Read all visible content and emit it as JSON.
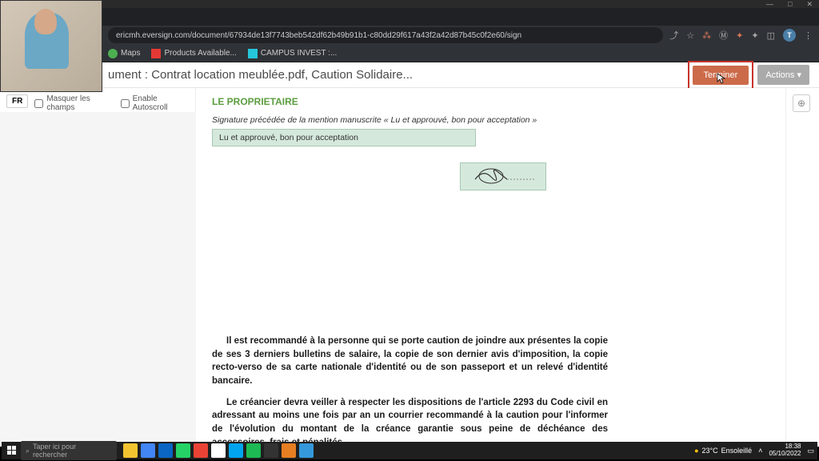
{
  "window": {
    "minimize": "—",
    "maximize": "□",
    "close": "✕"
  },
  "browser": {
    "url": "ericmh.eversign.com/document/67934de13f7743beb542df62b49b91b1-c80dd29f617a43f2a42d87b45c0f2e60/sign",
    "bookmarks": [
      {
        "label": "Maps",
        "color": "#4caf50"
      },
      {
        "label": "Products Available...",
        "color": "#e53935"
      },
      {
        "label": "CAMPUS INVEST :...",
        "color": "#26c6da"
      }
    ]
  },
  "app": {
    "title": "ument : Contrat location meublée.pdf, Caution Solidaire...",
    "terminer": "Terminer",
    "actions": "Actions ▾",
    "lang": "FR",
    "masquer": "Masquer les champs",
    "autoscroll": "Enable Autoscroll",
    "zoom": "⊕"
  },
  "doc": {
    "heading": "LE PROPRIETAIRE",
    "instruction": "Signature précédée de la mention manuscrite « Lu et approuvé, bon pour acceptation »",
    "approval": "Lu et approuvé, bon pour acceptation",
    "para1": "Il est recommandé à la personne qui se porte caution de joindre aux présentes la copie de ses 3 derniers bulletins de salaire, la copie de son dernier avis d'imposition, la copie recto-verso de sa carte nationale d'identité ou de son passeport et un relevé d'identité bancaire.",
    "para2": "Le créancier devra veiller à respecter les dispositions de l'article 2293 du Code civil en adressant au moins une fois par an un courrier recommandé à la caution pour l'informer de l'évolution du montant de la créance garantie sous peine de déchéance des accessoires, frais et pénalités."
  },
  "taskbar": {
    "search": "Taper ici pour rechercher",
    "weather_temp": "23°C",
    "weather_text": "Ensoleillé",
    "time": "18:38",
    "date": "05/10/2022"
  }
}
